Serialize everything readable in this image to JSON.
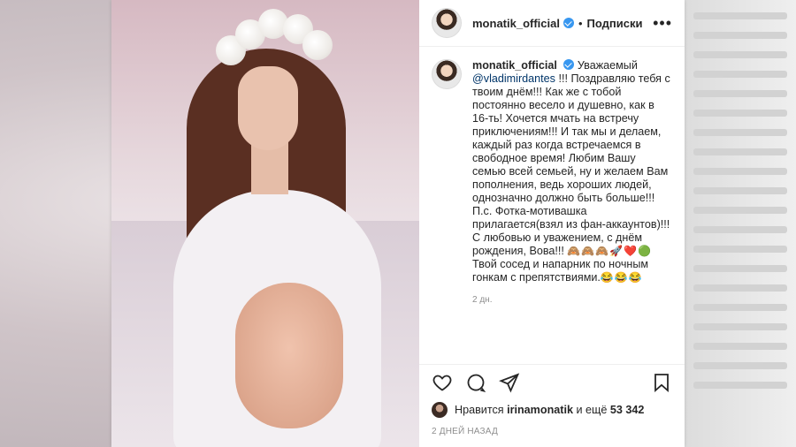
{
  "post": {
    "username": "monatik_official",
    "separator": "•",
    "follow_label": "Подписки",
    "more_label": "•••",
    "comment": {
      "username": "monatik_official",
      "text_before_mention": "Уважаемый",
      "mention": "@vladimirdantes",
      "text_after_mention": "!!! Поздравляю тебя с твоим днём!!! Как же с тобой постоянно весело и душевно, как в 16-ть! Хочется мчать на встречу приключениям!!! И так мы и делаем, каждый раз когда встречаемся в свободное время! Любим Вашу семью всей семьей, ну и желаем Вам пополнения, ведь хороших людей, однозначно должно быть больше!!! П.с. Фотка-мотивашка прилагается(взял из фан-аккаунтов)!!! С любовью и уважением, с днём рождения, Вова!!!",
      "emojis_1": "🙈🙈🙈🚀❤️🟢",
      "text_tail": "Твой сосед и напарник по ночным гонкам с препятствиями.",
      "emojis_2": "😂😂😂",
      "time": "2 дн."
    },
    "likes": {
      "prefix": "Нравится",
      "user": "irinamonatik",
      "middle": "и ещё",
      "count": "53 342"
    },
    "date": "2 ДНЕЙ НАЗАД"
  },
  "icons": [
    "heart-icon",
    "comment-icon",
    "share-icon",
    "bookmark-icon",
    "verified-icon",
    "more-icon"
  ],
  "colors": {
    "verified": "#3897f0",
    "text": "#262626",
    "muted": "#8e8e8e",
    "mention": "#003569"
  }
}
